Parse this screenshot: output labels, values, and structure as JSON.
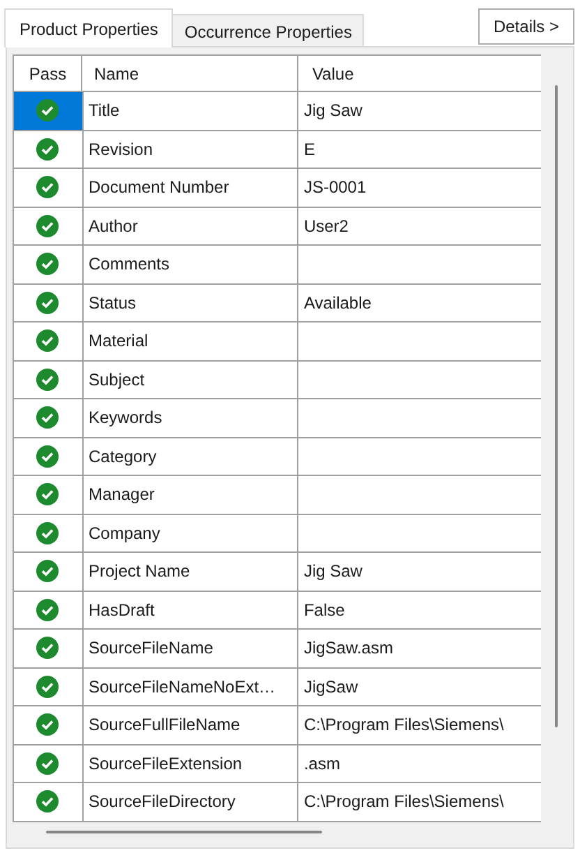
{
  "tabs": [
    {
      "label": "Product Properties",
      "selected": true
    },
    {
      "label": "Occurrence Properties",
      "selected": false
    }
  ],
  "details_button": "Details >",
  "table": {
    "columns": [
      "Pass",
      "Name",
      "Value"
    ],
    "rows": [
      {
        "pass": true,
        "selected": true,
        "name": "Title",
        "value": "Jig Saw"
      },
      {
        "pass": true,
        "selected": false,
        "name": "Revision",
        "value": "E"
      },
      {
        "pass": true,
        "selected": false,
        "name": "Document Number",
        "value": "JS-0001"
      },
      {
        "pass": true,
        "selected": false,
        "name": "Author",
        "value": "User2"
      },
      {
        "pass": true,
        "selected": false,
        "name": "Comments"
      },
      {
        "pass": true,
        "selected": false,
        "name": "Status",
        "value": "Available"
      },
      {
        "pass": true,
        "selected": false,
        "name": "Material"
      },
      {
        "pass": true,
        "selected": false,
        "name": "Subject"
      },
      {
        "pass": true,
        "selected": false,
        "name": "Keywords"
      },
      {
        "pass": true,
        "selected": false,
        "name": "Category"
      },
      {
        "pass": true,
        "selected": false,
        "name": "Manager"
      },
      {
        "pass": true,
        "selected": false,
        "name": "Company"
      },
      {
        "pass": true,
        "selected": false,
        "name": "Project Name",
        "value": "Jig Saw"
      },
      {
        "pass": true,
        "selected": false,
        "name": "HasDraft",
        "value": "False"
      },
      {
        "pass": true,
        "selected": false,
        "name": "SourceFileName",
        "value": "JigSaw.asm"
      },
      {
        "pass": true,
        "selected": false,
        "name": "SourceFileNameNoExt…",
        "value": "JigSaw"
      },
      {
        "pass": true,
        "selected": false,
        "name": "SourceFullFileName",
        "value": "C:\\Program Files\\Siemens\\"
      },
      {
        "pass": true,
        "selected": false,
        "name": "SourceFileExtension",
        "value": ".asm"
      },
      {
        "pass": true,
        "selected": false,
        "name": "SourceFileDirectory",
        "value": "C:\\Program Files\\Siemens\\"
      }
    ]
  }
}
